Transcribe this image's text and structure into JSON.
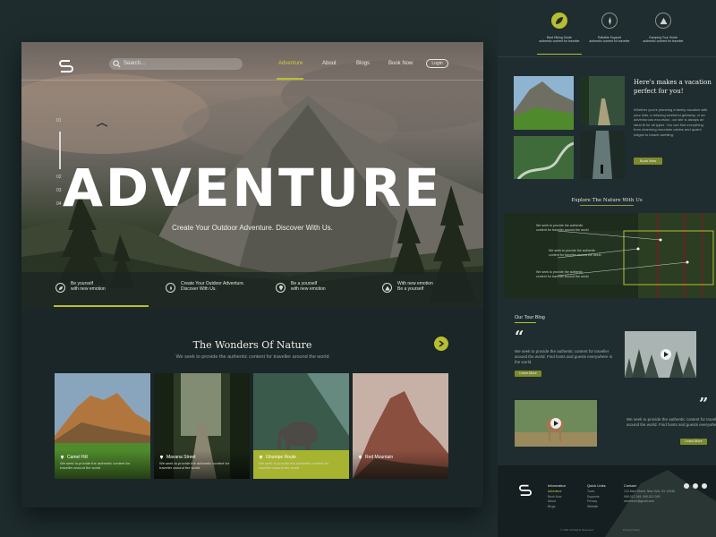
{
  "colors": {
    "accent": "#b7bf2e",
    "background": "#1e2c2e",
    "panel": "#1b2628"
  },
  "header": {
    "search_placeholder": "Search...",
    "nav": [
      "Adventure",
      "About",
      "Blogs",
      "Book Now"
    ],
    "login": "Login"
  },
  "hero": {
    "slides": [
      "01",
      "02",
      "03",
      "04"
    ],
    "title": "ADVENTURE",
    "subtitle": "Create Your Outdoor Adventure. Discover With Us.",
    "features": [
      {
        "icon": "leaf-icon",
        "line1": "Be yourself",
        "line2": "with new emotion"
      },
      {
        "icon": "compass-icon",
        "line1": "Create Your Outdoor Adventure.",
        "line2": "Discover With Us."
      },
      {
        "icon": "pin-icon",
        "line1": "Be a yourself",
        "line2": "with new emotion"
      },
      {
        "icon": "tent-icon",
        "line1": "With new emotion",
        "line2": "Be a yourself"
      }
    ]
  },
  "wonders": {
    "title": "The Wonders Of Nature",
    "subtitle": "We seek to provide the authentic content for  traveller around the world",
    "cards": [
      {
        "title": "Camel Hill",
        "desc": "We seek to provide the authentic content for  traveller around the world"
      },
      {
        "title": "Mavana Street",
        "desc": "We seek to provide the authentic content for  traveller around the world"
      },
      {
        "title": "Ghumpe Route",
        "desc": "We seek to provide the authentic content for  traveller around the world"
      },
      {
        "title": "Red Mountain",
        "desc": ""
      }
    ]
  },
  "right": {
    "top_icons": [
      {
        "icon": "leaf-icon",
        "label1": "Best Hiking Guide",
        "label2": "authentic content for traveller"
      },
      {
        "icon": "compass-icon",
        "label1": "Reliable Support",
        "label2": "authentic content for traveller"
      },
      {
        "icon": "tent-icon",
        "label1": "Camping Tour Guide",
        "label2": "authentic content for traveller"
      }
    ],
    "vacation": {
      "title": "Here's makes a vacation perfect for you!",
      "text": "Whether you're planning a family vacation with your kids, a relaxing weekend getaway, or an adventurous excursion, our site is always an ideal fit for all types. You can find everything from charming mountain cabins and quaint lodges to beach dwelling.",
      "button": "Book Now"
    },
    "explore": {
      "title": "Explore The Nature With Us",
      "labels": [
        "We seek to provide the authentic content for traveller around the world",
        "We seek to provide the authentic content for traveller around the world",
        "We seek to provide the authentic content for traveller around the world"
      ]
    },
    "blog": {
      "title": "Our Tour Blog",
      "post1": "We seek to provide the authentic content for  traveller around the world. Find hosts and guests everywhere in the world.",
      "post2": "We seek to provide the authentic content for  traveller around the world. Find hosts and guests everywhere.",
      "button": "Learn More"
    },
    "footer": {
      "col1_head": "Information",
      "col1_items": [
        "Adventure",
        "Book Now",
        "About",
        "Blogs"
      ],
      "col2_head": "Quick Links",
      "col2_items": [
        "Tours",
        "Supports",
        "Privacy",
        "Website"
      ],
      "col3_head": "Contact",
      "col3_items": [
        "123 Main Street, New York, NY 10036",
        "069-012-345, 069-012-345",
        "adventure@gmail.com"
      ],
      "copyright": "© 2021 All Rights Reserved",
      "privacy": "Privacy Policy"
    }
  }
}
